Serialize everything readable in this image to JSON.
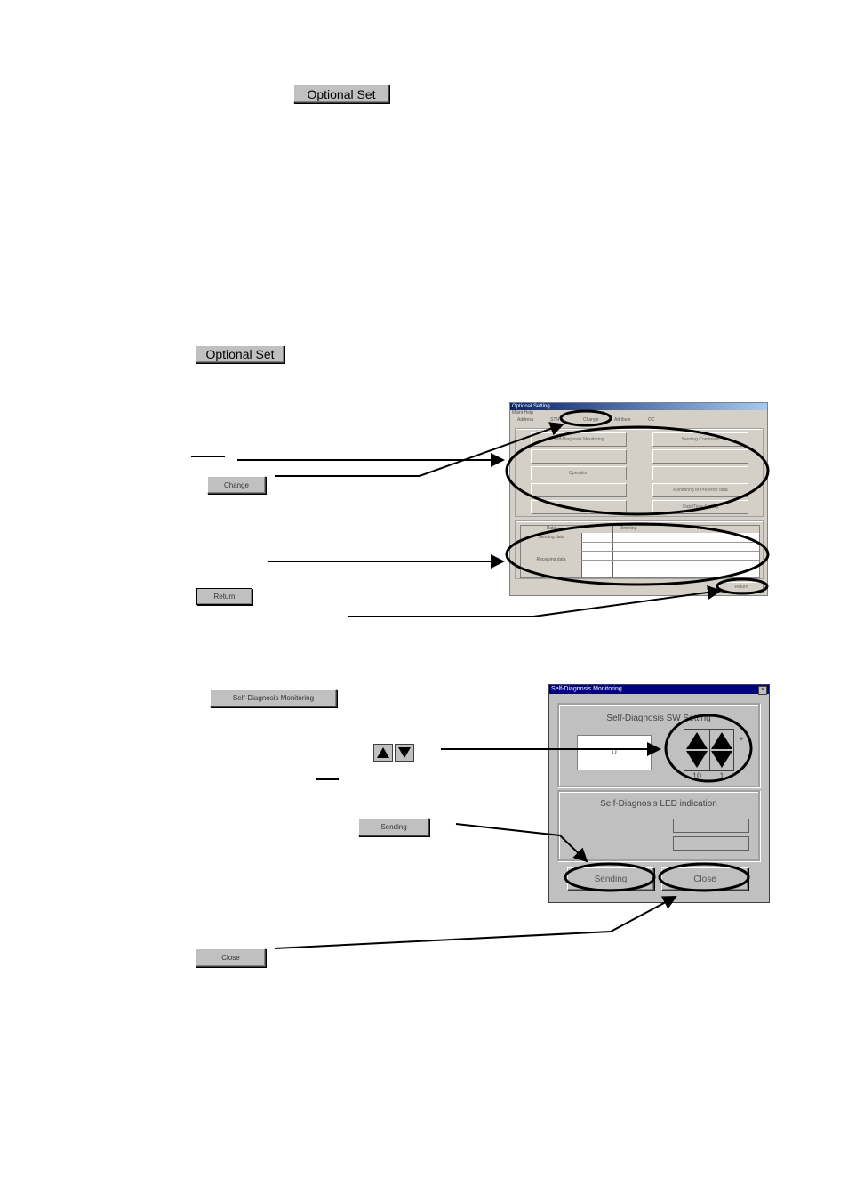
{
  "top_button": {
    "label": "Optional Set"
  },
  "section1": {
    "optional_set_button": {
      "label": "Optional Set"
    },
    "change_button": {
      "label": "Change"
    },
    "return_button": {
      "label": "Return"
    },
    "screenshot": {
      "title": "Optional Setting",
      "menu": "Maint  Help",
      "tabs": [
        "Address",
        "STN",
        "Change",
        "Attribute",
        "OC"
      ],
      "buttons_left": [
        "Self-Diagnosis Monitoring",
        "",
        "Operation",
        "",
        ""
      ],
      "buttons_right": [
        "Sending Command",
        "",
        "",
        "Monitoring of Pre-error data",
        "Data/Time Setting"
      ],
      "table_headers": [
        "Data",
        "",
        "Dimming",
        "Data"
      ],
      "table_rows": [
        "Sending data",
        "Receiving data"
      ],
      "return_label": "Return"
    }
  },
  "section2": {
    "self_diag_button": {
      "label": "Self-Diagnosis Monitoring"
    },
    "updown_icons": [
      "up-arrow",
      "down-arrow"
    ],
    "sending_button": {
      "label": "Sending"
    },
    "close_button": {
      "label": "Close"
    },
    "dialog": {
      "title": "Self-Diagnosis Monitoring",
      "sw_setting_label": "Self-Diagnosis SW Setting",
      "sw_value": "0",
      "spinner_labels": [
        "10",
        "1"
      ],
      "plus": "+",
      "minus": "-",
      "led_label": "Self-Diagnosis LED indication",
      "sending_label": "Sending",
      "close_label": "Close"
    }
  }
}
